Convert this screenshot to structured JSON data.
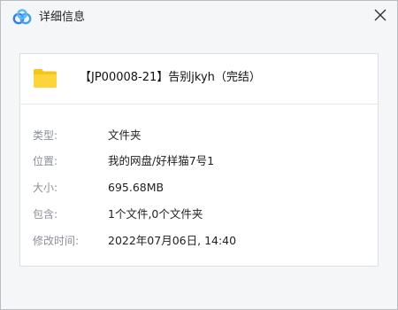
{
  "window": {
    "title": "详细信息",
    "app_icon": "baidu-netdisk-cloud-icon",
    "close_icon": "close-icon"
  },
  "file": {
    "icon": "folder-icon",
    "name": "【JP00008-21】告别jkyh（完结）"
  },
  "details": [
    {
      "label": "类型:",
      "value": "文件夹"
    },
    {
      "label": "位置:",
      "value": "我的网盘/好样猫7号1"
    },
    {
      "label": "大小:",
      "value": "695.68MB"
    },
    {
      "label": "包含:",
      "value": "1个文件,0个文件夹"
    },
    {
      "label": "修改时间:",
      "value": "2022年07月06日, 14:40"
    }
  ],
  "colors": {
    "folder": "#f5c518",
    "cloud_blue": "#2f7cf6",
    "cloud_light": "#7fb6ff"
  }
}
